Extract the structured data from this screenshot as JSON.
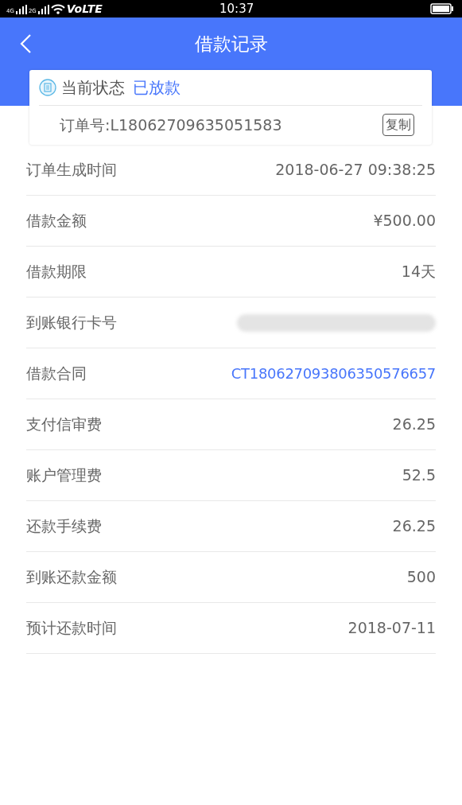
{
  "status_bar": {
    "network_1": "4G",
    "network_2": "2G",
    "volte": "VoLTE",
    "time": "10:37"
  },
  "header": {
    "title": "借款记录"
  },
  "status_card": {
    "label": "当前状态",
    "status": "已放款",
    "order_number": "订单号:L18062709635051583",
    "copy_button": "复制"
  },
  "rows": [
    {
      "kind": "text",
      "label": "订单生成时间",
      "value": "2018-06-27 09:38:25"
    },
    {
      "kind": "text",
      "label": "借款金额",
      "value": "¥500.00"
    },
    {
      "kind": "text",
      "label": "借款期限",
      "value": "14天"
    },
    {
      "kind": "redacted",
      "label": "到账银行卡号"
    },
    {
      "kind": "link",
      "label": "借款合同",
      "value": "CT180627093806350576657"
    },
    {
      "kind": "text",
      "label": "支付信审费",
      "value": "26.25"
    },
    {
      "kind": "text",
      "label": "账户管理费",
      "value": "52.5"
    },
    {
      "kind": "text",
      "label": "还款手续费",
      "value": "26.25"
    },
    {
      "kind": "text",
      "label": "到账还款金额",
      "value": "500"
    },
    {
      "kind": "text",
      "label": "预计还款时间",
      "value": "2018-07-11"
    }
  ]
}
